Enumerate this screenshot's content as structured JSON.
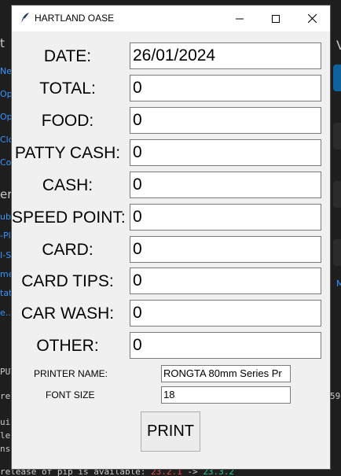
{
  "window": {
    "title": "HARTLAND OASE"
  },
  "fields": [
    {
      "label": "DATE:",
      "value": "26/01/2024"
    },
    {
      "label": "TOTAL:",
      "value": "0"
    },
    {
      "label": "FOOD:",
      "value": "0"
    },
    {
      "label": "PATTY CASH:",
      "value": "0"
    },
    {
      "label": "CASH:",
      "value": "0"
    },
    {
      "label": "SPEED POINT:",
      "value": "0"
    },
    {
      "label": "CARD:",
      "value": "0"
    },
    {
      "label": "CARD TIPS:",
      "value": "0"
    },
    {
      "label": "CAR WASH:",
      "value": "0"
    },
    {
      "label": "OTHER:",
      "value": "0"
    }
  ],
  "printer": {
    "label": "PRINTER NAME:",
    "value": "RONGTA 80mm Series Pr"
  },
  "font_size": {
    "label": "FONT SIZE",
    "value": "18"
  },
  "print_button": {
    "label": "PRINT"
  },
  "background": {
    "left_header_1": "t",
    "left_items_1": [
      "Ne",
      "Op",
      "Op",
      "Clo",
      "Co"
    ],
    "left_header_2": "er",
    "left_items_2": [
      "ub",
      "-Pl",
      "I-S",
      "me",
      "tat",
      "e..."
    ],
    "right_header": "V",
    "right_letter": "M",
    "term_lines": [
      "PUT",
      "rec",
      "",
      "uil",
      "lec",
      "nst"
    ],
    "term_right": "59",
    "term_bottom_prefix": "release of pip is available: ",
    "term_bottom_old": "23.2.1",
    "term_bottom_arrow": " -> ",
    "term_bottom_new": "23.3.2"
  }
}
